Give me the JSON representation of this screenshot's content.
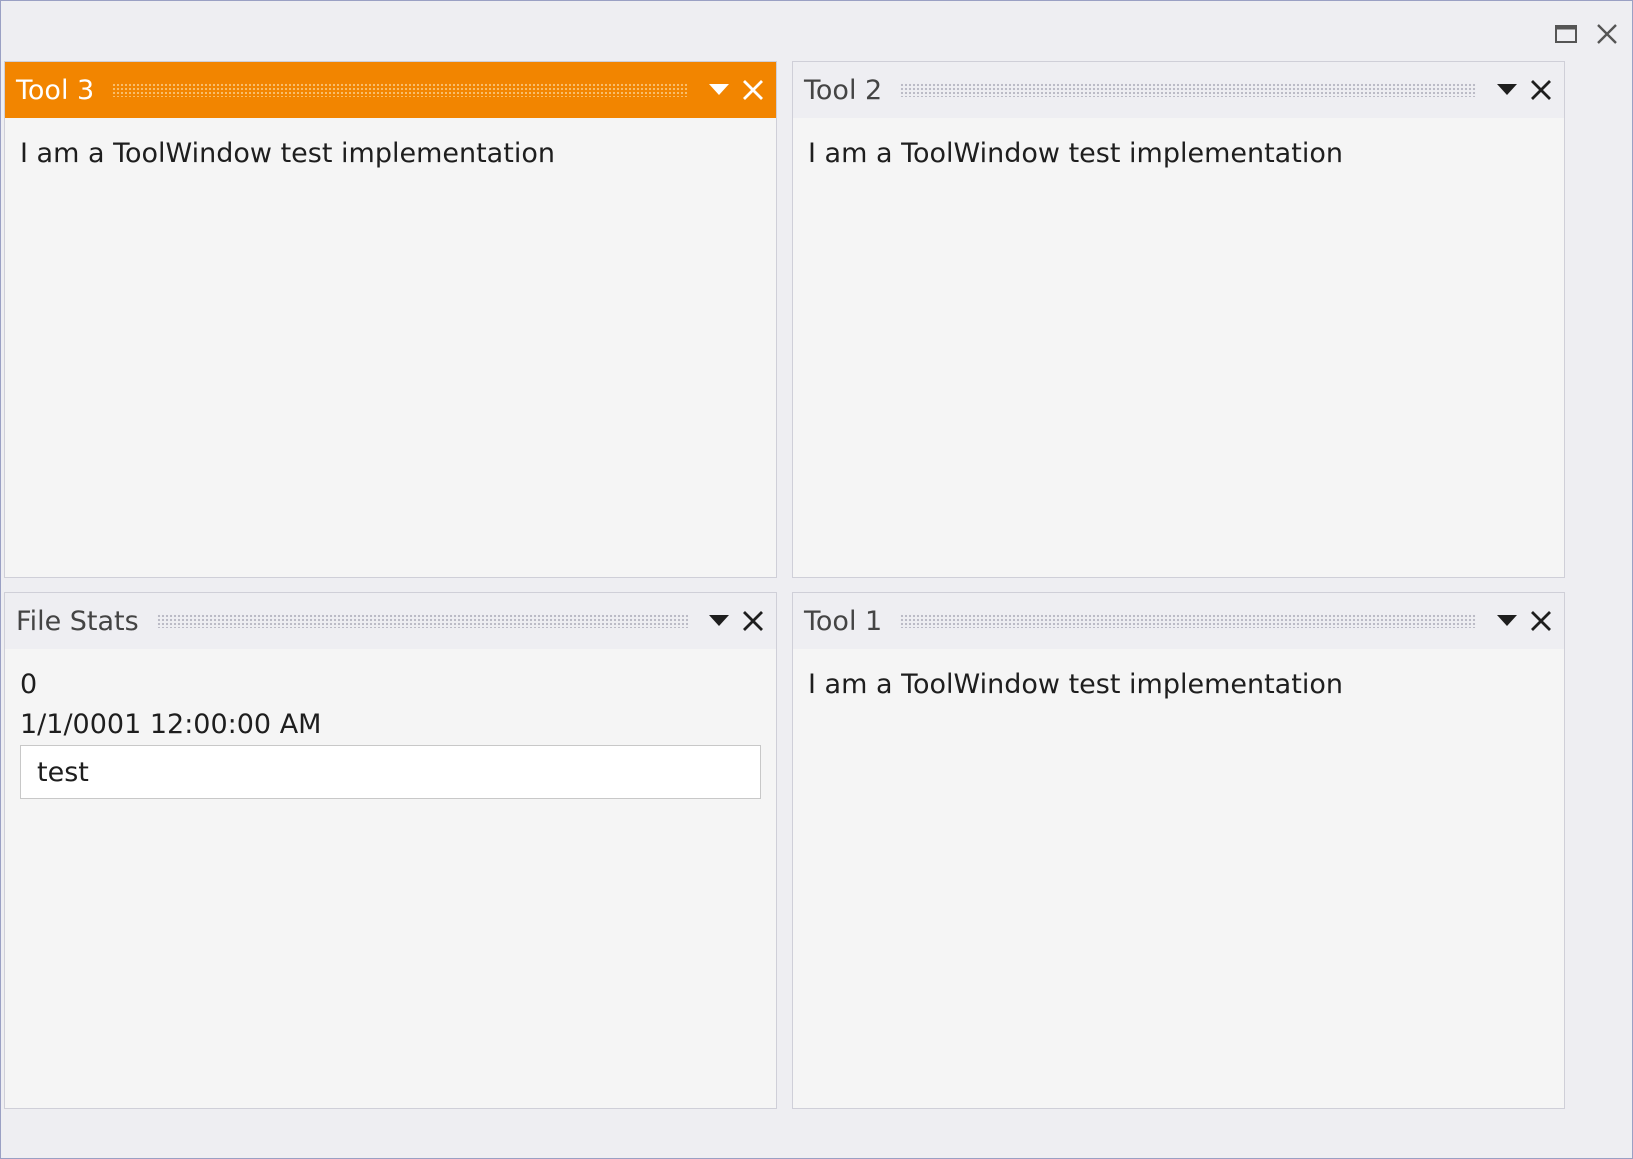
{
  "window": {
    "icons": {
      "maximize": "maximize-icon",
      "close": "close-icon"
    }
  },
  "panes": {
    "tool3": {
      "title": "Tool 3",
      "active": true,
      "body": "I am a ToolWindow test implementation"
    },
    "tool2": {
      "title": "Tool 2",
      "active": false,
      "body": "I am a ToolWindow test implementation"
    },
    "file_stats": {
      "title": "File Stats",
      "active": false,
      "value": "0",
      "date": "1/1/0001 12:00:00 AM",
      "input_value": "test"
    },
    "tool1": {
      "title": "Tool 1",
      "active": false,
      "body": "I am a ToolWindow test implementation"
    }
  },
  "colors": {
    "active_header": "#f28500",
    "header": "#eeeef2",
    "pane_background": "#f5f5f5",
    "window_border": "#9aa0c4"
  }
}
